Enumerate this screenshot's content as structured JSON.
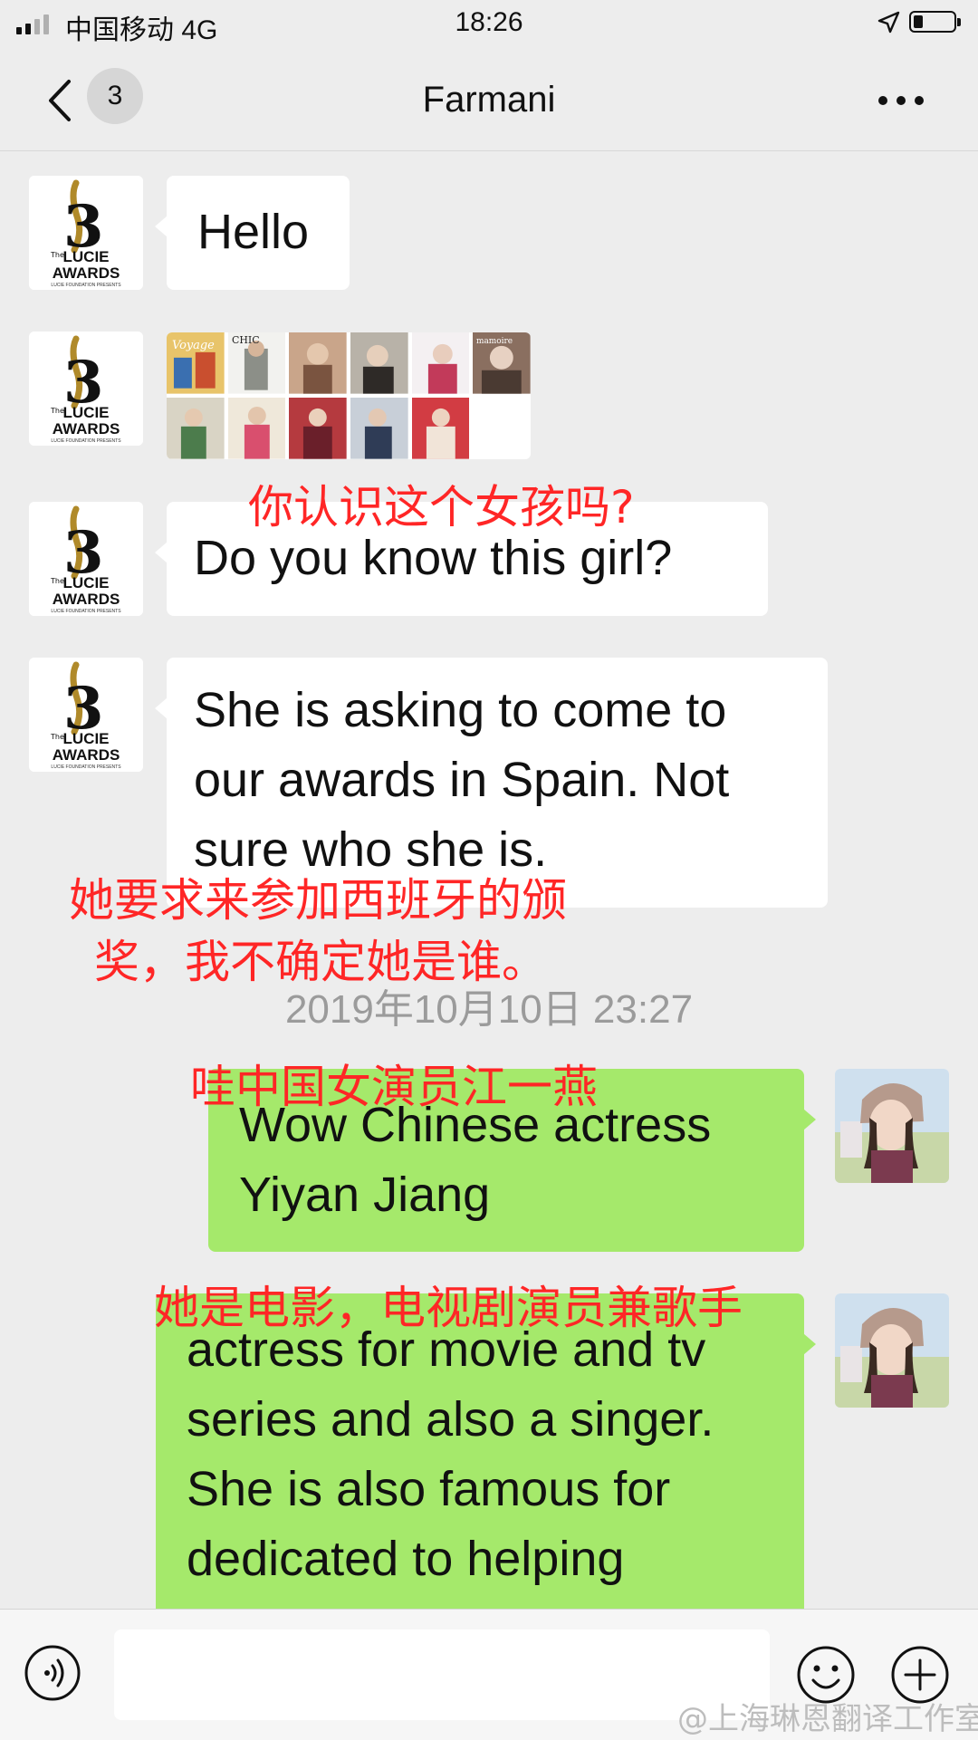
{
  "status_bar": {
    "carrier": "中国移动 4G",
    "time": "18:26"
  },
  "nav": {
    "unread_count": "3",
    "title": "Farmani"
  },
  "avatar_logo": {
    "number": "3",
    "small": "The",
    "line1": "LUCIE",
    "line2": "AWARDS",
    "tagline": "LUCIE FOUNDATION PRESENTS"
  },
  "messages": [
    {
      "sender": "Farmani",
      "type": "text",
      "text": "Hello"
    },
    {
      "sender": "Farmani",
      "type": "image_grid"
    },
    {
      "sender": "Farmani",
      "type": "text",
      "text": "Do you know this girl?"
    },
    {
      "sender": "Farmani",
      "type": "text",
      "lines": [
        "She is asking to come to",
        "our awards in Spain. Not",
        "sure who she is."
      ]
    },
    {
      "sender": "me",
      "type": "text",
      "lines": [
        "Wow Chinese actress",
        "Yiyan Jiang"
      ]
    },
    {
      "sender": "me",
      "type": "text",
      "lines": [
        "actress for movie and tv",
        "series and also a singer.",
        "She is also famous for",
        "dedicated to helping"
      ]
    }
  ],
  "thumbnail_labels": [
    "Voyage",
    "CHIC",
    "",
    "",
    "",
    "mamoire"
  ],
  "timestamp": "2019年10月10日 23:27",
  "annotations": {
    "a1": "你认识这个女孩吗?",
    "a2_line1": "她要求来参加西班牙的颁",
    "a2_line2": "奖，我不确定她是谁。",
    "a3": "哇中国女演员江一燕",
    "a4": "她是电影，电视剧演员兼歌手"
  },
  "watermark": "@上海琳恩翻译工作室",
  "colors": {
    "background": "#ededed",
    "bubble_in": "#ffffff",
    "bubble_out": "#a5e96b",
    "annotation": "#ff2626",
    "timestamp": "#9b9b9b"
  },
  "icons": {
    "back": "chevron-left-icon",
    "more": "ellipsis-icon",
    "voice": "voice-icon",
    "emoji": "emoji-icon",
    "plus": "plus-icon",
    "location": "location-arrow-icon"
  }
}
